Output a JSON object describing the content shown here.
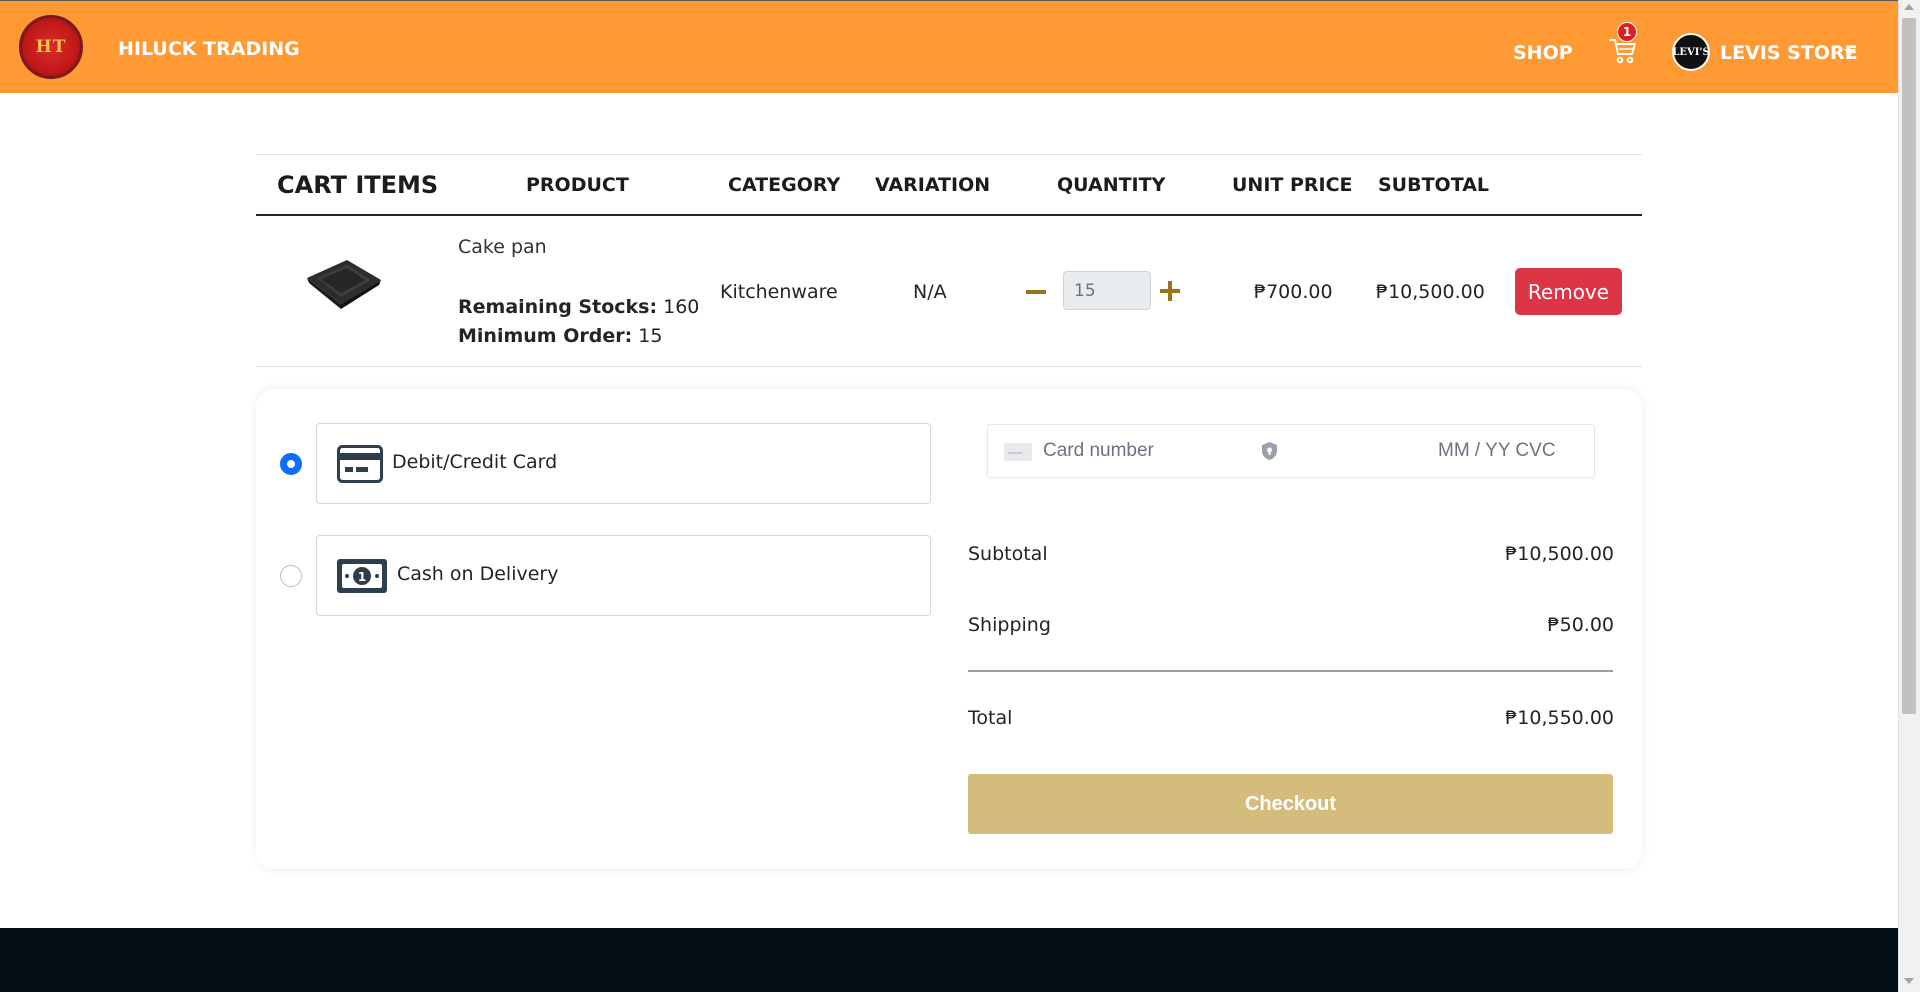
{
  "header": {
    "brand_logo_text": "HT",
    "brand_name": "HILUCK TRADING",
    "shop_label": "SHOP",
    "cart_count": "1",
    "store_avatar_text": "LEVI'S",
    "store_name": "LEVIS STORE",
    "accent_color": "#ff9933"
  },
  "cart": {
    "headers": {
      "cart_items": "CART ITEMS",
      "product": "PRODUCT",
      "category": "CATEGORY",
      "variation": "VARIATION",
      "quantity": "QUANTITY",
      "unit_price": "UNIT PRICE",
      "subtotal": "SUBTOTAL"
    },
    "items": [
      {
        "name": "Cake pan",
        "remaining_label": "Remaining Stocks:",
        "remaining_value": "160",
        "min_order_label": "Minimum Order:",
        "min_order_value": "15",
        "category": "Kitchenware",
        "variation": "N/A",
        "quantity": "15",
        "unit_price": "₱700.00",
        "subtotal": "₱10,500.00",
        "remove_label": "Remove"
      }
    ]
  },
  "payment": {
    "options": [
      {
        "label": "Debit/Credit Card",
        "icon": "credit-card-icon",
        "selected": true
      },
      {
        "label": "Cash on Delivery",
        "icon": "cash-icon",
        "selected": false
      }
    ],
    "card_field": {
      "placeholder_number": "Card number",
      "placeholder_expiry_cvc": "MM / YY  CVC"
    }
  },
  "summary": {
    "subtotal_label": "Subtotal",
    "subtotal_value": "₱10,500.00",
    "shipping_label": "Shipping",
    "shipping_value": "₱50.00",
    "total_label": "Total",
    "total_value": "₱10,550.00",
    "checkout_label": "Checkout",
    "checkout_color": "#d4bc7d"
  }
}
